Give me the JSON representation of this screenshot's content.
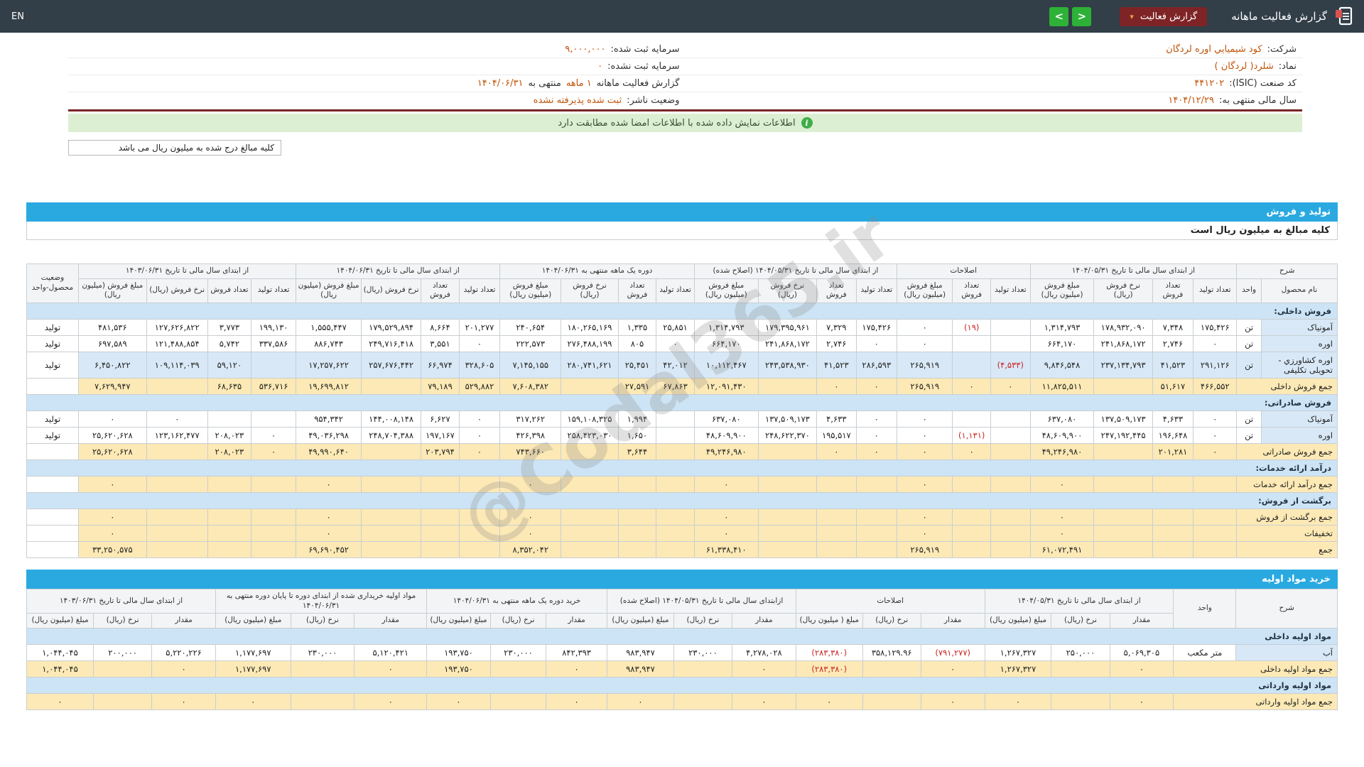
{
  "colors": {
    "navbar_bg": "#323e48",
    "accent_blue": "#2aa9e1",
    "button_red": "#7e2426",
    "button_green": "#2db237",
    "sum_row_yellow": "#fce9b5",
    "section_row_blue": "#cce4f5",
    "name_cell_blue": "#d8e8f6",
    "value_orange": "#c25408",
    "negative_red": "#cc2222",
    "signed_bar_green": "#dcefd2",
    "underline_maroon": "#7a2626"
  },
  "navbar": {
    "title": "گزارش فعالیت ماهانه",
    "report_button": "گزارش فعالیت",
    "caret": "▾",
    "arrow_left": "<",
    "arrow_right": ">",
    "lang": "EN"
  },
  "info": {
    "right": [
      {
        "label": "شرکت:",
        "value": "کود شیمیايي اوره لردگان"
      },
      {
        "label": "نماد:",
        "value": "شلرد( لردگان )"
      },
      {
        "label": "کد صنعت (ISIC):",
        "value": "۴۴۱۲۰۲"
      },
      {
        "label": "سال مالی منتهی به:",
        "value": "۱۴۰۴/۱۲/۲۹"
      }
    ],
    "left": [
      {
        "label": "سرمایه ثبت شده:",
        "value": "۹,۰۰۰,۰۰۰"
      },
      {
        "label": "سرمایه ثبت نشده:",
        "value": "۰"
      },
      {
        "label": "گزارش فعالیت ماهانه",
        "value": "۱ ماهه",
        "label2": "منتهی به",
        "value2": "۱۴۰۴/۰۶/۳۱"
      },
      {
        "label": "وضعیت ناشر:",
        "value": "ثبت شده پذیرفته نشده"
      }
    ],
    "signed_message": "اطلاعات نمایش داده شده با اطلاعات امضا شده مطابقت دارد",
    "unit_note": "کلیه مبالغ درج شده به میلیون ریال می باشد"
  },
  "sales_table": {
    "bar_title": "تولید و فروش",
    "note": "کلیه مبالغ به میلیون ریال است",
    "header": {
      "desc": "شرح",
      "name": "نام محصول",
      "unit": "واحد",
      "status": "وضعیت محصول-واحد",
      "groups": [
        {
          "title": "از ابتدای سال مالی تا تاریخ ۱۴۰۴/۰۵/۳۱",
          "cols": [
            "تعداد تولید",
            "تعداد فروش",
            "نرخ فروش (ریال)",
            "مبلغ فروش (میلیون ریال)"
          ]
        },
        {
          "title": "اصلاحات",
          "cols": [
            "تعداد تولید",
            "تعداد فروش",
            "مبلغ فروش (میلیون ریال)"
          ]
        },
        {
          "title": "از ابتدای سال مالی تا تاریخ ۱۴۰۴/۰۵/۳۱ (اصلاح شده)",
          "cols": [
            "تعداد تولید",
            "تعداد فروش",
            "نرخ فروش (ریال)",
            "مبلغ فروش (میلیون ریال)"
          ]
        },
        {
          "title": "دوره یک ماهه منتهی به ۱۴۰۴/۰۶/۳۱",
          "cols": [
            "تعداد تولید",
            "تعداد فروش",
            "نرخ فروش (ریال)",
            "مبلغ فروش (میلیون ریال)"
          ]
        },
        {
          "title": "از ابتدای سال مالی تا تاریخ ۱۴۰۴/۰۶/۳۱",
          "cols": [
            "تعداد تولید",
            "تعداد فروش",
            "نرخ فروش (ریال)",
            "مبلغ فروش (میلیون ریال)"
          ]
        },
        {
          "title": "از ابتدای سال مالی تا تاریخ ۱۴۰۳/۰۶/۳۱",
          "cols": [
            "تعداد تولید",
            "تعداد فروش",
            "نرخ فروش (ریال)",
            "مبلغ فروش (میلیون ریال)"
          ]
        }
      ]
    },
    "rows": [
      {
        "type": "section",
        "label": "فروش داخلی:"
      },
      {
        "type": "product",
        "name": "آمونیاک",
        "unit": "تن",
        "status": "تولید",
        "highlight": false,
        "cells": [
          "۱۷۵,۴۲۶",
          "۷,۳۴۸",
          "۱۷۸,۹۳۲,۰۹۰",
          "۱,۳۱۴,۷۹۳",
          "",
          "(۱۹)",
          "۰",
          "۱۷۵,۴۲۶",
          "۷,۳۲۹",
          "۱۷۹,۳۹۵,۹۶۱",
          "۱,۳۱۴,۷۹۳",
          "۲۵,۸۵۱",
          "۱,۳۳۵",
          "۱۸۰,۲۶۵,۱۶۹",
          "۲۴۰,۶۵۴",
          "۲۰۱,۲۷۷",
          "۸,۶۶۴",
          "۱۷۹,۵۲۹,۸۹۴",
          "۱,۵۵۵,۴۴۷",
          "۱۹۹,۱۳۰",
          "۳,۷۷۳",
          "۱۲۷,۶۲۶,۸۲۲",
          "۴۸۱,۵۳۶"
        ]
      },
      {
        "type": "product",
        "name": "اوره",
        "unit": "تن",
        "status": "تولید",
        "highlight": false,
        "cells": [
          "۰",
          "۲,۷۴۶",
          "۲۴۱,۸۶۸,۱۷۲",
          "۶۶۴,۱۷۰",
          "",
          "",
          "۰",
          "۰",
          "۲,۷۴۶",
          "۲۴۱,۸۶۸,۱۷۲",
          "۶۶۴,۱۷۰",
          "۰",
          "۸۰۵",
          "۲۷۶,۴۸۸,۱۹۹",
          "۲۲۲,۵۷۳",
          "۰",
          "۳,۵۵۱",
          "۲۴۹,۷۱۶,۴۱۸",
          "۸۸۶,۷۴۳",
          "۳۳۷,۵۸۶",
          "۵,۷۴۲",
          "۱۲۱,۴۸۸,۸۵۴",
          "۶۹۷,۵۸۹"
        ]
      },
      {
        "type": "product",
        "name": "اوره کشاورزي - تحویلی تکلیفی",
        "unit": "تن",
        "status": "تولید",
        "highlight": true,
        "cells": [
          "۲۹۱,۱۲۶",
          "۴۱,۵۲۳",
          "۲۳۷,۱۳۴,۷۹۳",
          "۹,۸۴۶,۵۴۸",
          "(۴,۵۳۳)",
          "",
          "۲۶۵,۹۱۹",
          "۲۸۶,۵۹۳",
          "۴۱,۵۲۳",
          "۲۴۳,۵۳۸,۹۳۰",
          "۱۰,۱۱۲,۴۶۷",
          "۴۲,۰۱۲",
          "۲۵,۴۵۱",
          "۲۸۰,۷۴۱,۶۲۱",
          "۷,۱۴۵,۱۵۵",
          "۳۲۸,۶۰۵",
          "۶۶,۹۷۴",
          "۲۵۷,۶۷۶,۴۴۲",
          "۱۷,۲۵۷,۶۲۲",
          "",
          "۵۹,۱۲۰",
          "۱۰۹,۱۱۴,۰۳۹",
          "۶,۴۵۰,۸۲۲"
        ]
      },
      {
        "type": "sum",
        "name": "جمع فروش داخلی",
        "cells": [
          "۴۶۶,۵۵۲",
          "۵۱,۶۱۷",
          "",
          "۱۱,۸۲۵,۵۱۱",
          "۰",
          "۰",
          "۲۶۵,۹۱۹",
          "۰",
          "۰",
          "",
          "۱۲,۰۹۱,۴۳۰",
          "۶۷,۸۶۳",
          "۲۷,۵۹۱",
          "",
          "۷,۶۰۸,۳۸۲",
          "۵۲۹,۸۸۲",
          "۷۹,۱۸۹",
          "",
          "۱۹,۶۹۹,۸۱۲",
          "۵۳۶,۷۱۶",
          "۶۸,۶۳۵",
          "",
          "۷,۶۲۹,۹۴۷"
        ]
      },
      {
        "type": "section",
        "label": "فروش صادراتی:"
      },
      {
        "type": "product",
        "name": "آمونیاک",
        "unit": "تن",
        "status": "تولید",
        "highlight": false,
        "cells": [
          "۰",
          "۴,۶۳۳",
          "۱۳۷,۵۰۹,۱۷۳",
          "۶۳۷,۰۸۰",
          "",
          "",
          "۰",
          "۰",
          "۴,۶۳۳",
          "۱۳۷,۵۰۹,۱۷۳",
          "۶۳۷,۰۸۰",
          "",
          "۱,۹۹۴",
          "۱۵۹,۱۰۸,۳۲۵",
          "۳۱۷,۲۶۲",
          "۰",
          "۶,۶۲۷",
          "۱۴۴,۰۰۸,۱۴۸",
          "۹۵۴,۳۴۲",
          "",
          "",
          "۰",
          "۰"
        ]
      },
      {
        "type": "product",
        "name": "اوره",
        "unit": "تن",
        "status": "تولید",
        "highlight": false,
        "cells": [
          "۰",
          "۱۹۶,۶۴۸",
          "۲۴۷,۱۹۲,۴۴۵",
          "۴۸,۶۰۹,۹۰۰",
          "",
          "(۱,۱۳۱)",
          "۰",
          "۰",
          "۱۹۵,۵۱۷",
          "۲۴۸,۶۲۲,۳۷۰",
          "۴۸,۶۰۹,۹۰۰",
          "",
          "۱,۶۵۰",
          "۲۵۸,۴۲۳,۰۳۰",
          "۴۲۶,۳۹۸",
          "۰",
          "۱۹۷,۱۶۷",
          "۲۴۸,۷۰۴,۳۸۸",
          "۴۹,۰۳۶,۲۹۸",
          "۰",
          "۲۰۸,۰۲۳",
          "۱۲۳,۱۶۲,۴۷۷",
          "۲۵,۶۲۰,۶۲۸"
        ]
      },
      {
        "type": "sum",
        "name": "جمع فروش صادراتی",
        "cells": [
          "۰",
          "۲۰۱,۲۸۱",
          "",
          "۴۹,۲۴۶,۹۸۰",
          "",
          "۰",
          "۰",
          "۰",
          "۰",
          "",
          "۴۹,۲۴۶,۹۸۰",
          "",
          "۳,۶۴۴",
          "",
          "۷۴۳,۶۶۰",
          "۰",
          "۲۰۳,۷۹۴",
          "",
          "۴۹,۹۹۰,۶۴۰",
          "۰",
          "۲۰۸,۰۲۳",
          "",
          "۲۵,۶۲۰,۶۲۸"
        ]
      },
      {
        "type": "section",
        "label": "درآمد ارائه خدمات:"
      },
      {
        "type": "sum",
        "name": "جمع درآمد ارائه خدمات",
        "cells": [
          "",
          "",
          "",
          "۰",
          "",
          "",
          "۰",
          "",
          "",
          "",
          "۰",
          "",
          "",
          "",
          "۰",
          "",
          "",
          "",
          "۰",
          "",
          "",
          "",
          "۰"
        ]
      },
      {
        "type": "section",
        "label": "برگشت از فروش:"
      },
      {
        "type": "sum",
        "name": "جمع برگشت از فروش",
        "cells": [
          "",
          "",
          "",
          "۰",
          "",
          "",
          "۰",
          "",
          "",
          "",
          "۰",
          "",
          "",
          "",
          "۰",
          "",
          "",
          "",
          "۰",
          "",
          "",
          "",
          "۰"
        ]
      },
      {
        "type": "sum",
        "name": "تخفیفات",
        "cells": [
          "",
          "",
          "",
          "۰",
          "",
          "",
          "۰",
          "",
          "",
          "",
          "۰",
          "",
          "",
          "",
          "۰",
          "",
          "",
          "",
          "۰",
          "",
          "",
          "",
          "۰"
        ]
      },
      {
        "type": "sum",
        "name": "جمع",
        "cells": [
          "",
          "",
          "",
          "۶۱,۰۷۲,۴۹۱",
          "",
          "",
          "۲۶۵,۹۱۹",
          "",
          "",
          "",
          "۶۱,۳۳۸,۴۱۰",
          "",
          "",
          "",
          "۸,۳۵۲,۰۴۲",
          "",
          "",
          "",
          "۶۹,۶۹۰,۴۵۲",
          "",
          "",
          "",
          "۳۳,۲۵۰,۵۷۵"
        ]
      }
    ]
  },
  "materials_table": {
    "bar_title": "خرید مواد اولیه",
    "header": {
      "desc": "شرح",
      "unit": "واحد",
      "groups": [
        {
          "title": "از ابتدای سال مالی تا تاریخ ۱۴۰۴/۰۵/۳۱",
          "cols": [
            "مقدار",
            "نرخ (ریال)",
            "مبلغ (میلیون ریال)"
          ]
        },
        {
          "title": "اصلاحات",
          "cols": [
            "مقدار",
            "نرخ (ریال)",
            "مبلغ ( میلیون ریال)"
          ]
        },
        {
          "title": "ازابتدای سال مالی تا تاریخ ۱۴۰۴/۰۵/۳۱ (اصلاح شده)",
          "cols": [
            "مقدار",
            "نرخ (ریال)",
            "مبلغ (میلیون ریال)"
          ]
        },
        {
          "title": "خرید دوره یک ماهه منتهی به ۱۴۰۴/۰۶/۳۱",
          "cols": [
            "مقدار",
            "نرخ (ریال)",
            "مبلغ (میلیون ریال)"
          ]
        },
        {
          "title": "مواد اولیه خریداری شده از ابتدای دوره تا پایان دوره منتهی به ۱۴۰۴/۰۶/۳۱",
          "cols": [
            "مقدار",
            "نرخ (ریال)",
            "مبلغ (میلیون ریال)"
          ]
        },
        {
          "title": "از ابتدای سال مالی تا تاریخ ۱۴۰۳/۰۶/۳۱",
          "cols": [
            "مقدار",
            "نرخ (ریال)",
            "مبلغ (میلیون ریال)"
          ]
        }
      ]
    },
    "rows": [
      {
        "type": "section",
        "label": "مواد اولیه داخلی"
      },
      {
        "type": "product",
        "name": "آب",
        "unit": "متر مکعب",
        "highlight": false,
        "cells": [
          "۵,۰۶۹,۳۰۵",
          "۲۵۰,۰۰۰",
          "۱,۲۶۷,۳۲۷",
          "(۷۹۱,۲۷۷)",
          "۳۵۸,۱۲۹.۹۶",
          "(۲۸۳,۳۸۰)",
          "۴,۲۷۸,۰۲۸",
          "۲۳۰,۰۰۰",
          "۹۸۳,۹۴۷",
          "۸۴۲,۳۹۳",
          "۲۳۰,۰۰۰",
          "۱۹۳,۷۵۰",
          "۵,۱۲۰,۴۲۱",
          "۲۳۰,۰۰۰",
          "۱,۱۷۷,۶۹۷",
          "۵,۲۲۰,۲۲۶",
          "۲۰۰,۰۰۰",
          "۱,۰۴۴,۰۴۵"
        ]
      },
      {
        "type": "sum",
        "name": "جمع مواد اولیه داخلی",
        "cells": [
          "۰",
          "",
          "۱,۲۶۷,۳۲۷",
          "۰",
          "",
          "(۲۸۳,۳۸۰)",
          "۰",
          "",
          "۹۸۳,۹۴۷",
          "۰",
          "",
          "۱۹۳,۷۵۰",
          "۰",
          "",
          "۱,۱۷۷,۶۹۷",
          "۰",
          "",
          "۱,۰۴۴,۰۴۵"
        ]
      },
      {
        "type": "section",
        "label": "مواد اولیه وارداتی"
      },
      {
        "type": "sum",
        "name": "جمع مواد اولیه وارداتی",
        "cells": [
          "۰",
          "",
          "۰",
          "۰",
          "",
          "۰",
          "۰",
          "",
          "۰",
          "۰",
          "",
          "۰",
          "۰",
          "",
          "۰",
          "۰",
          "",
          "۰"
        ]
      }
    ]
  },
  "watermark": "@Codal365.ir"
}
